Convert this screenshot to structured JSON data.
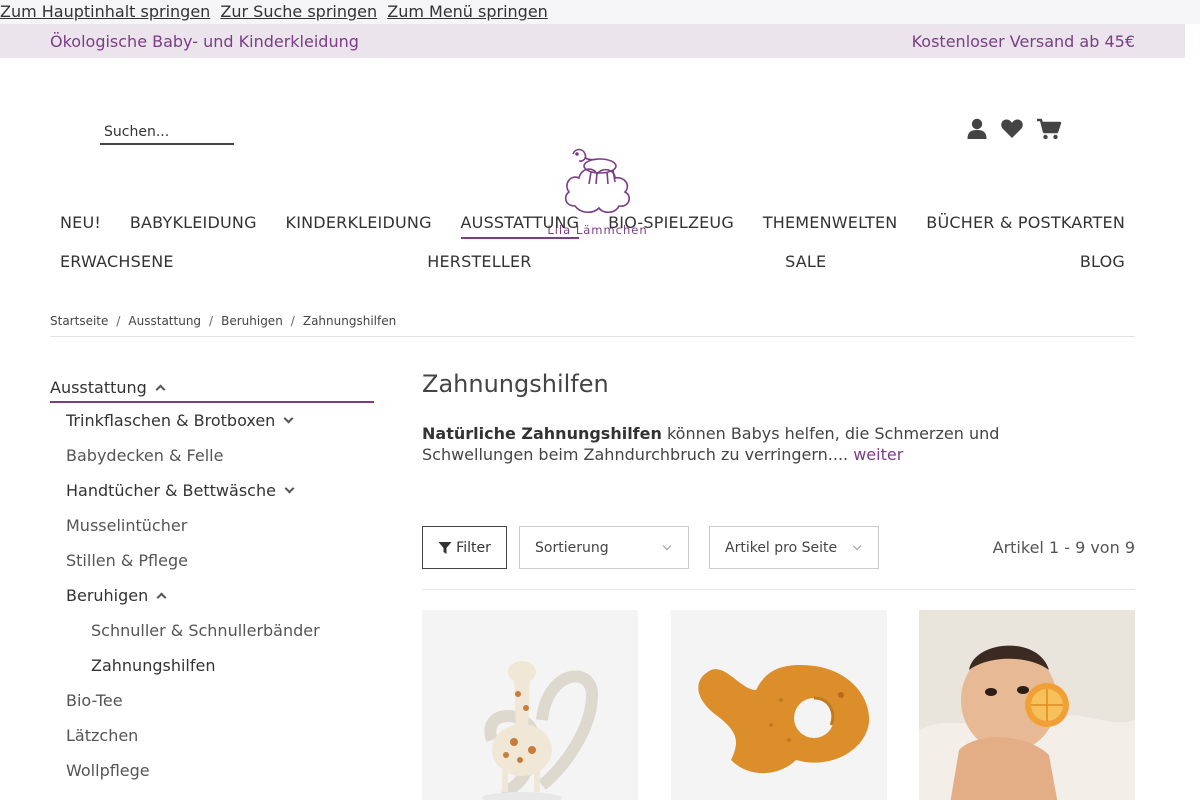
{
  "skip_links": [
    "Zum Hauptinhalt springen",
    "Zur Suche springen",
    "Zum Menü springen"
  ],
  "topbar": {
    "left": "Ökologische Baby- und Kinderkleidung",
    "right": "Kostenloser Versand ab 45€"
  },
  "search": {
    "placeholder": "Suchen..."
  },
  "logo": {
    "text": "Lila Lämmchen"
  },
  "header_icons": [
    "user-icon",
    "heart-icon",
    "cart-icon"
  ],
  "nav": {
    "row1": [
      "NEU!",
      "BABYKLEIDUNG",
      "KINDERKLEIDUNG",
      "AUSSTATTUNG",
      "BIO-SPIELZEUG",
      "THEMENWELTEN",
      "BÜCHER & POSTKARTEN"
    ],
    "row2": [
      "ERWACHSENE",
      "HERSTELLER",
      "SALE",
      "BLOG"
    ],
    "active": "AUSSTATTUNG"
  },
  "breadcrumb": [
    "Startseite",
    "Ausstattung",
    "Beruhigen",
    "Zahnungshilfen"
  ],
  "sidebar": {
    "head": "Ausstattung",
    "items": [
      "Trinkflaschen & Brotboxen",
      "Babydecken & Felle",
      "Handtücher & Bettwäsche",
      "Musselintücher",
      "Stillen & Pflege",
      "Beruhigen",
      "Schnuller & Schnullerbänder",
      "Zahnungshilfen",
      "Bio-Tee",
      "Lätzchen",
      "Wollpflege"
    ]
  },
  "main": {
    "title": "Zahnungshilfen",
    "intro_bold": "Natürliche Zahnungshilfen",
    "intro_rest": " können Babys helfen, die Schmerzen und Schwellungen beim Zahndurchbruch zu verringern.... ",
    "more": "weiter"
  },
  "toolbar": {
    "filter": "Filter",
    "sort": "Sortierung",
    "per_page": "Artikel pro Seite",
    "count": "Artikel 1 - 9 von 9"
  },
  "colors": {
    "brand": "#7a3d86",
    "topbar_bg": "#ebe4ec"
  }
}
